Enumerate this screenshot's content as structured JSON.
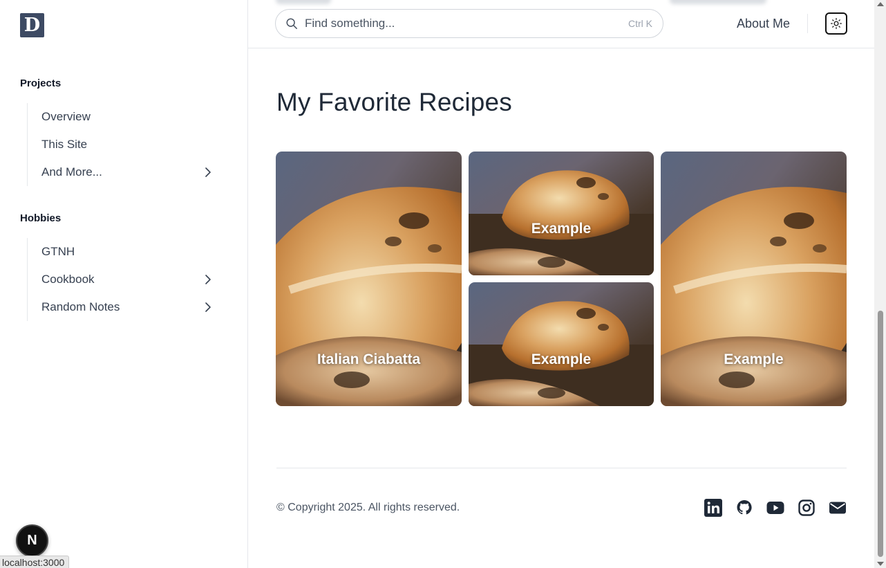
{
  "sidebar": {
    "logo_letter": "D",
    "sections": [
      {
        "title": "Projects",
        "items": [
          {
            "label": "Overview",
            "has_children": false
          },
          {
            "label": "This Site",
            "has_children": false
          },
          {
            "label": "And More...",
            "has_children": true
          }
        ]
      },
      {
        "title": "Hobbies",
        "items": [
          {
            "label": "GTNH",
            "has_children": false
          },
          {
            "label": "Cookbook",
            "has_children": true
          },
          {
            "label": "Random Notes",
            "has_children": true
          }
        ]
      }
    ],
    "dev_badge": "N",
    "status_url": "localhost:3000"
  },
  "header": {
    "search": {
      "placeholder": "Find something...",
      "shortcut": "Ctrl K"
    },
    "about_label": "About Me",
    "theme_toggle_icon": "sun-icon"
  },
  "main": {
    "title": "My Favorite Recipes",
    "cards": [
      {
        "label": "Italian Ciabatta",
        "image": "bread-photo"
      },
      {
        "label": "Example",
        "image": "bread-photo"
      },
      {
        "label": "Example",
        "image": "bread-photo"
      },
      {
        "label": "Example",
        "image": "bread-photo"
      }
    ]
  },
  "footer": {
    "copyright": "© Copyright 2025. All rights reserved.",
    "social_icons": [
      "linkedin-icon",
      "github-icon",
      "youtube-icon",
      "instagram-icon",
      "mail-icon"
    ]
  },
  "colors": {
    "logo_bg": "#3d4a63",
    "text": "#1f2937",
    "border": "#e5e7eb"
  }
}
